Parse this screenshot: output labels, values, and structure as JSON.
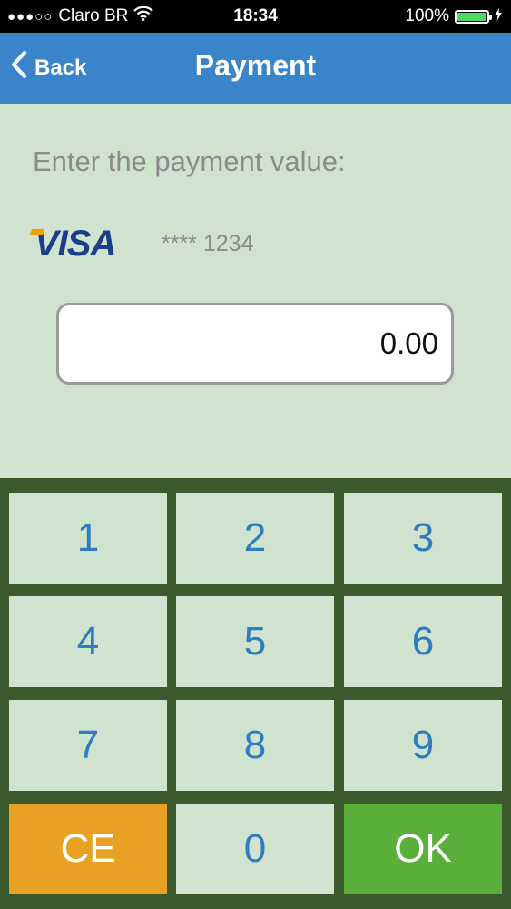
{
  "status_bar": {
    "signal_dots": "●●●○○",
    "carrier": "Claro BR",
    "wifi_icon": "wifi-icon",
    "time": "18:34",
    "battery_percent": "100%",
    "battery_level": 1.0
  },
  "nav": {
    "back_label": "Back",
    "title": "Payment"
  },
  "main": {
    "prompt": "Enter the payment value:",
    "card_brand": "VISA",
    "card_masked": "**** 1234",
    "amount": "0.00"
  },
  "keypad": {
    "keys": [
      "1",
      "2",
      "3",
      "4",
      "5",
      "6",
      "7",
      "8",
      "9",
      "CE",
      "0",
      "OK"
    ]
  },
  "colors": {
    "nav": "#3a85c9",
    "background": "#cfe3cf",
    "keypad_bg": "#3b5a2e",
    "ce": "#e8a123",
    "ok": "#5aaf3b"
  }
}
